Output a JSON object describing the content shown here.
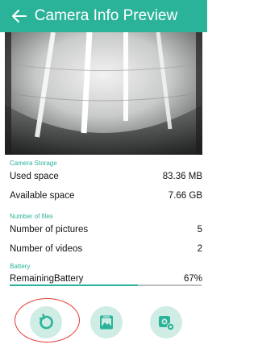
{
  "header": {
    "title": "Camera Info Preview",
    "back_icon": "arrow-left-icon"
  },
  "storage": {
    "section_label": "Camera Storage",
    "rows": [
      {
        "label": "Used space",
        "value": "83.36 MB"
      },
      {
        "label": "Available space",
        "value": "7.66 GB"
      }
    ]
  },
  "files": {
    "section_label": "Number of files",
    "rows": [
      {
        "label": "Number of pictures",
        "value": "5"
      },
      {
        "label": "Number of videos",
        "value": "2"
      }
    ]
  },
  "battery": {
    "section_label": "Battery",
    "label": "RemainingBattery",
    "value": "67%",
    "fraction": 0.67
  },
  "actions": [
    {
      "icon": "refresh-icon"
    },
    {
      "icon": "gallery-icon"
    },
    {
      "icon": "camera-settings-icon"
    }
  ],
  "colors": {
    "accent": "#2bb39a",
    "button_bg": "#cfece5",
    "highlight": "#e53935"
  }
}
